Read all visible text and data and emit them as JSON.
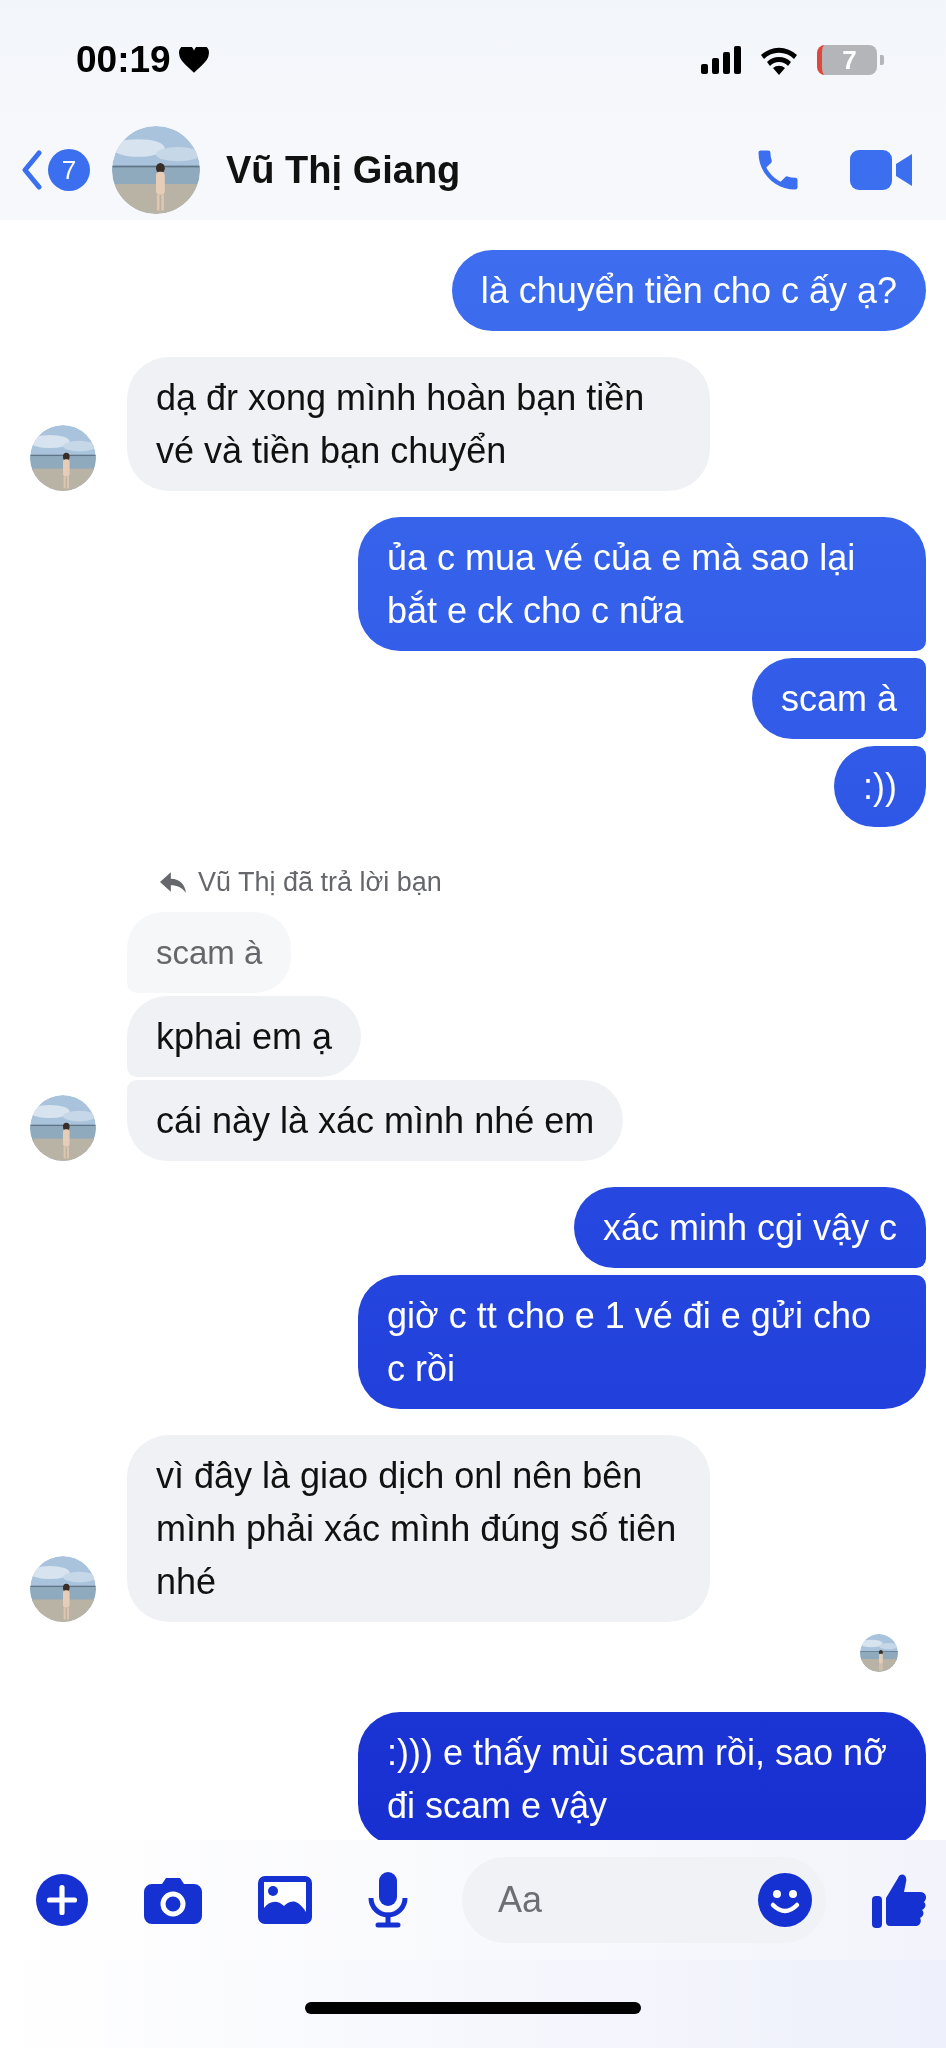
{
  "status_bar": {
    "time": "00:19",
    "battery": "7"
  },
  "header": {
    "back_badge": "7",
    "contact_name": "Vũ Thị Giang"
  },
  "messages": [
    {
      "kind": "outgoing",
      "text": "là chuyển tiền cho c ấy ạ?"
    },
    {
      "kind": "incoming",
      "text": "dạ đr xong mình hoàn bạn tiền vé và tiền bạn chuyển",
      "avatar": true
    },
    {
      "kind": "outgoing",
      "text": "ủa c mua vé của e mà sao lại bắt e ck cho c nữa"
    },
    {
      "kind": "outgoing",
      "text": "scam à"
    },
    {
      "kind": "outgoing",
      "text": ":))"
    },
    {
      "kind": "reply_note",
      "text": "Vũ Thị đã trả lời bạn"
    },
    {
      "kind": "quoted",
      "text": "scam à"
    },
    {
      "kind": "incoming",
      "text": "kphai em ạ",
      "avatar": false
    },
    {
      "kind": "incoming",
      "text": "cái này là xác mình nhé em",
      "avatar": true
    },
    {
      "kind": "outgoing",
      "text": "xác minh cgi vậy c"
    },
    {
      "kind": "outgoing",
      "text": "giờ c tt cho e 1 vé đi e gửi cho c rồi"
    },
    {
      "kind": "incoming",
      "text": "vì đây là giao dịch onl nên bên mình phải xác mình đúng số tiên nhé",
      "avatar": true
    },
    {
      "kind": "read_receipt"
    },
    {
      "kind": "outgoing",
      "text": ":))) e thấy mùi scam rồi, sao nỡ đi scam e vậy"
    }
  ],
  "composer": {
    "placeholder": "Aa"
  }
}
